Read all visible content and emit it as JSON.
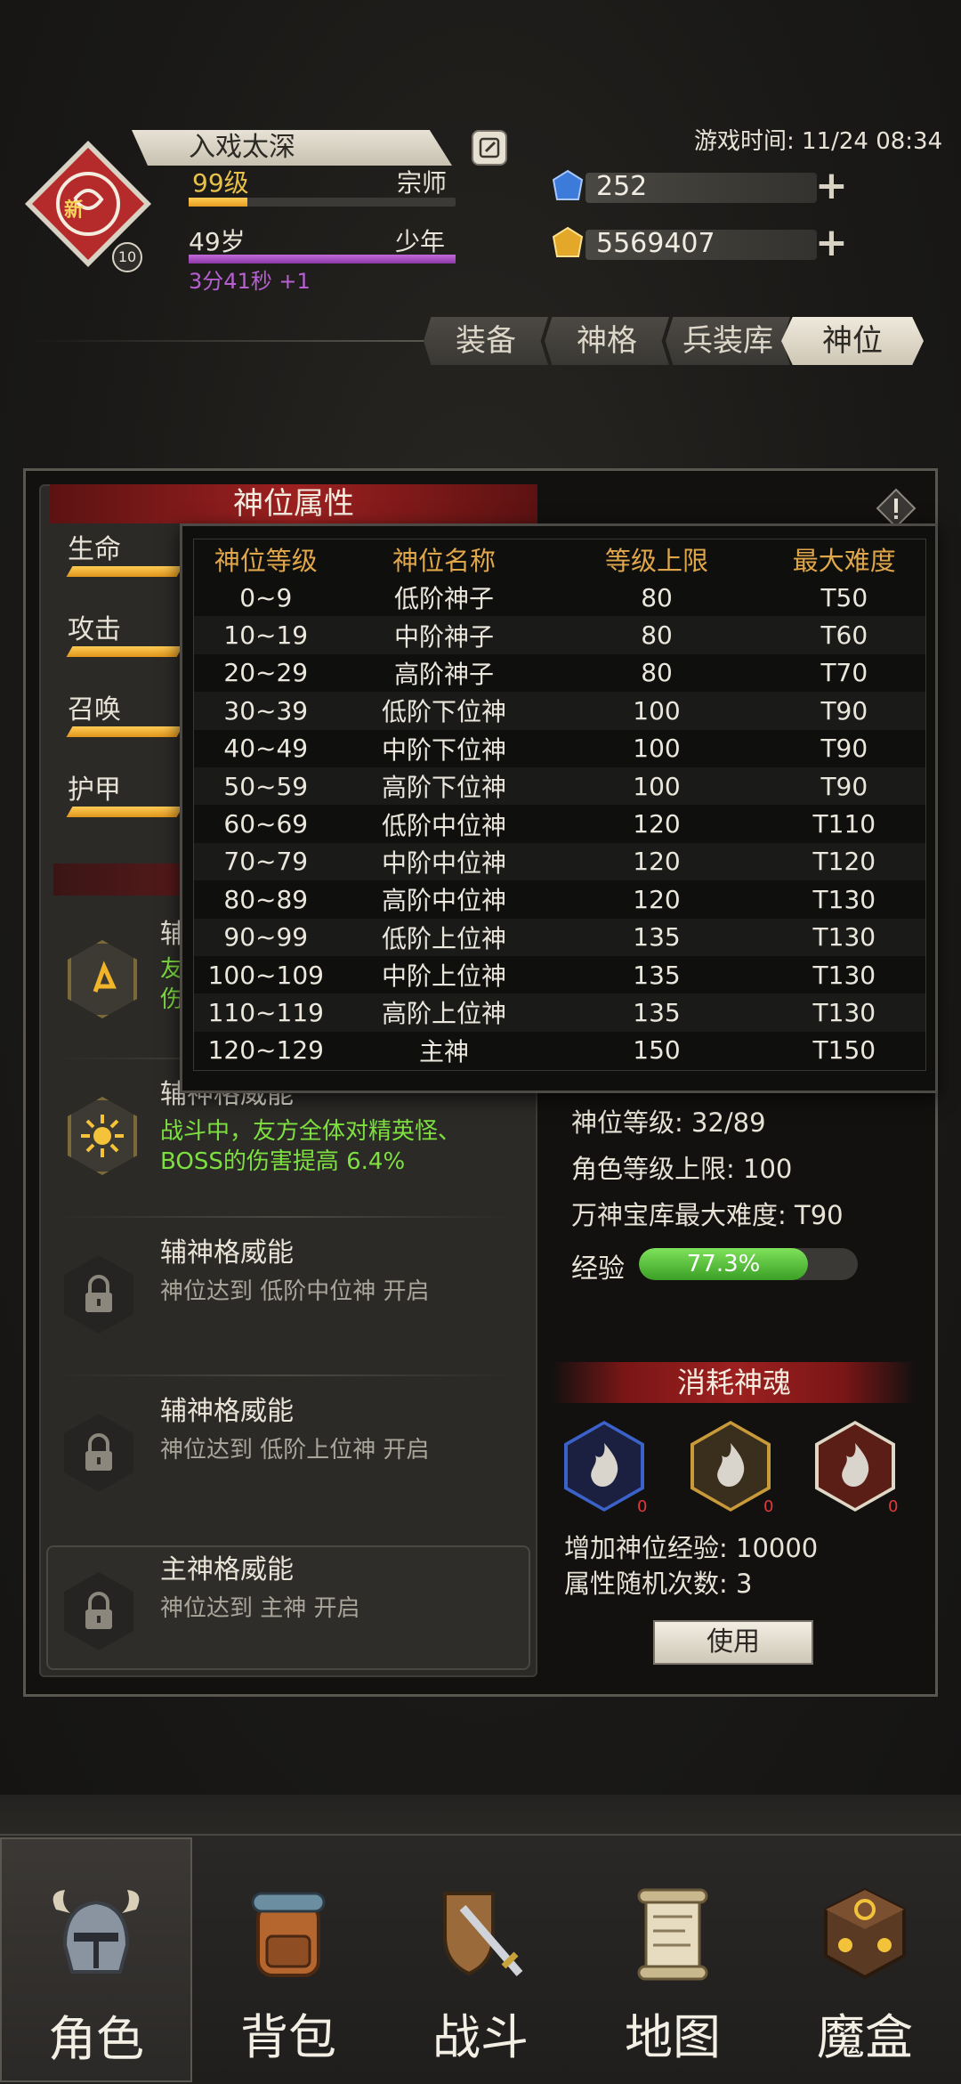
{
  "header": {
    "player_name": "入戏太深",
    "level": "99级",
    "rank": "宗师",
    "level_badge": "10",
    "emblem_tag": "新",
    "age": "49岁",
    "life_stage": "少年",
    "timer": "3分41秒 +1",
    "game_time": "游戏时间: 11/24 08:34",
    "currency_gems": "252",
    "currency_gold": "5569407",
    "plus_symbol": "+"
  },
  "tabs": [
    {
      "label": "装备"
    },
    {
      "label": "神格"
    },
    {
      "label": "兵装库"
    },
    {
      "label": "神位"
    }
  ],
  "left_panel": {
    "title": "神位属性",
    "stats": [
      {
        "label": "生命"
      },
      {
        "label": "攻击"
      },
      {
        "label": "召唤"
      },
      {
        "label": "护甲"
      }
    ],
    "abilities": [
      {
        "title": "辅",
        "desc": "友",
        "desc2": "伤"
      },
      {
        "title": "辅神格威能",
        "desc": "战斗中，友方全体对精英怪、",
        "desc2": "BOSS的伤害提高 6.4%"
      },
      {
        "title": "辅神格威能",
        "desc": "神位达到 低阶中位神 开启"
      },
      {
        "title": "辅神格威能",
        "desc": "神位达到 低阶上位神 开启"
      },
      {
        "title": "主神格威能",
        "desc": "神位达到 主神 开启"
      }
    ]
  },
  "right_panel": {
    "divine_level": "神位等级: 32/89",
    "char_level_cap": "角色等级上限: 100",
    "vault_max": "万神宝库最大难度: T90",
    "exp_label": "经验",
    "exp_value": "77.3%",
    "exp_fraction": 0.773,
    "soul_title": "消耗神魂",
    "souls": [
      {
        "count": "0",
        "color": "#3a62c8"
      },
      {
        "count": "0",
        "color": "#c89a3a"
      },
      {
        "count": "0",
        "color": "#c8502a"
      }
    ],
    "gain_exp": "增加神位经验: 10000",
    "random_times": "属性随机次数: 3",
    "use_button": "使用"
  },
  "popup": {
    "headers": [
      "神位等级",
      "神位名称",
      "等级上限",
      "最大难度"
    ],
    "rows": [
      [
        "0~9",
        "低阶神子",
        "80",
        "T50"
      ],
      [
        "10~19",
        "中阶神子",
        "80",
        "T60"
      ],
      [
        "20~29",
        "高阶神子",
        "80",
        "T70"
      ],
      [
        "30~39",
        "低阶下位神",
        "100",
        "T90"
      ],
      [
        "40~49",
        "中阶下位神",
        "100",
        "T90"
      ],
      [
        "50~59",
        "高阶下位神",
        "100",
        "T90"
      ],
      [
        "60~69",
        "低阶中位神",
        "120",
        "T110"
      ],
      [
        "70~79",
        "中阶中位神",
        "120",
        "T120"
      ],
      [
        "80~89",
        "高阶中位神",
        "120",
        "T130"
      ],
      [
        "90~99",
        "低阶上位神",
        "135",
        "T130"
      ],
      [
        "100~109",
        "中阶上位神",
        "135",
        "T130"
      ],
      [
        "110~119",
        "高阶上位神",
        "135",
        "T130"
      ],
      [
        "120~129",
        "主神",
        "150",
        "T150"
      ]
    ]
  },
  "bottom_nav": [
    {
      "label": "角色",
      "icon": "helmet-icon",
      "active": true
    },
    {
      "label": "背包",
      "icon": "backpack-icon",
      "active": false
    },
    {
      "label": "战斗",
      "icon": "sword-shield-icon",
      "active": false
    },
    {
      "label": "地图",
      "icon": "scroll-map-icon",
      "active": false
    },
    {
      "label": "魔盒",
      "icon": "magic-cube-icon",
      "active": false
    }
  ],
  "colors": {
    "accent_gold": "#e7c14a",
    "accent_purple": "#b760d1",
    "banner_red": "#9d2020",
    "exp_green": "#5fcf3c",
    "ability_green": "#7ee040",
    "table_header": "#e0a64a"
  }
}
